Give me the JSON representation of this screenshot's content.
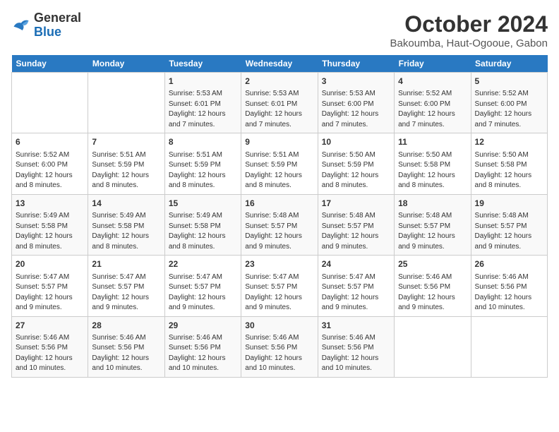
{
  "header": {
    "logo_line1": "General",
    "logo_line2": "Blue",
    "title": "October 2024",
    "subtitle": "Bakoumba, Haut-Ogooue, Gabon"
  },
  "calendar": {
    "days_of_week": [
      "Sunday",
      "Monday",
      "Tuesday",
      "Wednesday",
      "Thursday",
      "Friday",
      "Saturday"
    ],
    "weeks": [
      [
        {
          "day": "",
          "info": ""
        },
        {
          "day": "",
          "info": ""
        },
        {
          "day": "1",
          "info": "Sunrise: 5:53 AM\nSunset: 6:01 PM\nDaylight: 12 hours and 7 minutes."
        },
        {
          "day": "2",
          "info": "Sunrise: 5:53 AM\nSunset: 6:01 PM\nDaylight: 12 hours and 7 minutes."
        },
        {
          "day": "3",
          "info": "Sunrise: 5:53 AM\nSunset: 6:00 PM\nDaylight: 12 hours and 7 minutes."
        },
        {
          "day": "4",
          "info": "Sunrise: 5:52 AM\nSunset: 6:00 PM\nDaylight: 12 hours and 7 minutes."
        },
        {
          "day": "5",
          "info": "Sunrise: 5:52 AM\nSunset: 6:00 PM\nDaylight: 12 hours and 7 minutes."
        }
      ],
      [
        {
          "day": "6",
          "info": "Sunrise: 5:52 AM\nSunset: 6:00 PM\nDaylight: 12 hours and 8 minutes."
        },
        {
          "day": "7",
          "info": "Sunrise: 5:51 AM\nSunset: 5:59 PM\nDaylight: 12 hours and 8 minutes."
        },
        {
          "day": "8",
          "info": "Sunrise: 5:51 AM\nSunset: 5:59 PM\nDaylight: 12 hours and 8 minutes."
        },
        {
          "day": "9",
          "info": "Sunrise: 5:51 AM\nSunset: 5:59 PM\nDaylight: 12 hours and 8 minutes."
        },
        {
          "day": "10",
          "info": "Sunrise: 5:50 AM\nSunset: 5:59 PM\nDaylight: 12 hours and 8 minutes."
        },
        {
          "day": "11",
          "info": "Sunrise: 5:50 AM\nSunset: 5:58 PM\nDaylight: 12 hours and 8 minutes."
        },
        {
          "day": "12",
          "info": "Sunrise: 5:50 AM\nSunset: 5:58 PM\nDaylight: 12 hours and 8 minutes."
        }
      ],
      [
        {
          "day": "13",
          "info": "Sunrise: 5:49 AM\nSunset: 5:58 PM\nDaylight: 12 hours and 8 minutes."
        },
        {
          "day": "14",
          "info": "Sunrise: 5:49 AM\nSunset: 5:58 PM\nDaylight: 12 hours and 8 minutes."
        },
        {
          "day": "15",
          "info": "Sunrise: 5:49 AM\nSunset: 5:58 PM\nDaylight: 12 hours and 8 minutes."
        },
        {
          "day": "16",
          "info": "Sunrise: 5:48 AM\nSunset: 5:57 PM\nDaylight: 12 hours and 9 minutes."
        },
        {
          "day": "17",
          "info": "Sunrise: 5:48 AM\nSunset: 5:57 PM\nDaylight: 12 hours and 9 minutes."
        },
        {
          "day": "18",
          "info": "Sunrise: 5:48 AM\nSunset: 5:57 PM\nDaylight: 12 hours and 9 minutes."
        },
        {
          "day": "19",
          "info": "Sunrise: 5:48 AM\nSunset: 5:57 PM\nDaylight: 12 hours and 9 minutes."
        }
      ],
      [
        {
          "day": "20",
          "info": "Sunrise: 5:47 AM\nSunset: 5:57 PM\nDaylight: 12 hours and 9 minutes."
        },
        {
          "day": "21",
          "info": "Sunrise: 5:47 AM\nSunset: 5:57 PM\nDaylight: 12 hours and 9 minutes."
        },
        {
          "day": "22",
          "info": "Sunrise: 5:47 AM\nSunset: 5:57 PM\nDaylight: 12 hours and 9 minutes."
        },
        {
          "day": "23",
          "info": "Sunrise: 5:47 AM\nSunset: 5:57 PM\nDaylight: 12 hours and 9 minutes."
        },
        {
          "day": "24",
          "info": "Sunrise: 5:47 AM\nSunset: 5:57 PM\nDaylight: 12 hours and 9 minutes."
        },
        {
          "day": "25",
          "info": "Sunrise: 5:46 AM\nSunset: 5:56 PM\nDaylight: 12 hours and 9 minutes."
        },
        {
          "day": "26",
          "info": "Sunrise: 5:46 AM\nSunset: 5:56 PM\nDaylight: 12 hours and 10 minutes."
        }
      ],
      [
        {
          "day": "27",
          "info": "Sunrise: 5:46 AM\nSunset: 5:56 PM\nDaylight: 12 hours and 10 minutes."
        },
        {
          "day": "28",
          "info": "Sunrise: 5:46 AM\nSunset: 5:56 PM\nDaylight: 12 hours and 10 minutes."
        },
        {
          "day": "29",
          "info": "Sunrise: 5:46 AM\nSunset: 5:56 PM\nDaylight: 12 hours and 10 minutes."
        },
        {
          "day": "30",
          "info": "Sunrise: 5:46 AM\nSunset: 5:56 PM\nDaylight: 12 hours and 10 minutes."
        },
        {
          "day": "31",
          "info": "Sunrise: 5:46 AM\nSunset: 5:56 PM\nDaylight: 12 hours and 10 minutes."
        },
        {
          "day": "",
          "info": ""
        },
        {
          "day": "",
          "info": ""
        }
      ]
    ]
  }
}
